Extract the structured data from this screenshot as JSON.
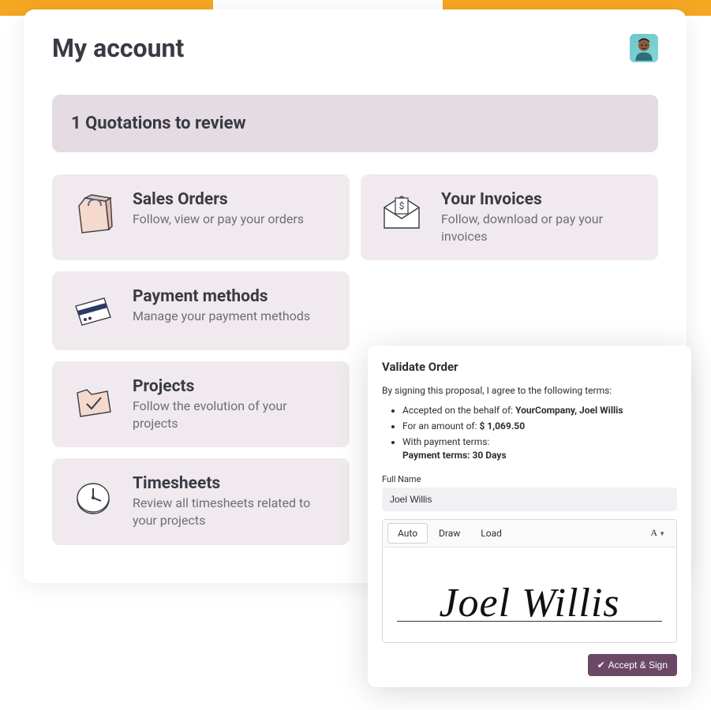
{
  "page": {
    "title": "My account"
  },
  "banner": {
    "text": "1  Quotations to review"
  },
  "tiles": {
    "sales_orders": {
      "title": "Sales Orders",
      "subtitle": "Follow, view or pay your orders"
    },
    "invoices": {
      "title": "Your Invoices",
      "subtitle": "Follow, download or pay your invoices"
    },
    "payment_methods": {
      "title": "Payment methods",
      "subtitle": "Manage your payment methods"
    },
    "projects": {
      "title": "Projects",
      "subtitle": "Follow the evolution of your projects"
    },
    "timesheets": {
      "title": "Timesheets",
      "subtitle": "Review all timesheets related to your projects"
    }
  },
  "validate": {
    "title": "Validate Order",
    "intro": "By signing this proposal, I agree to the following terms:",
    "accepted_prefix": "Accepted on the behalf of: ",
    "accepted_value": "YourCompany, Joel Willis",
    "amount_prefix": "For an amount of: ",
    "amount_value": "$ 1,069.50",
    "terms_prefix": "With payment terms:",
    "terms_value": "Payment terms: 30 Days",
    "fullname_label": "Full Name",
    "fullname_value": "Joel Willis",
    "tabs": {
      "auto": "Auto",
      "draw": "Draw",
      "load": "Load"
    },
    "font_btn": "A",
    "signature_text": "Joel Willis",
    "accept_label": "Accept & Sign"
  }
}
